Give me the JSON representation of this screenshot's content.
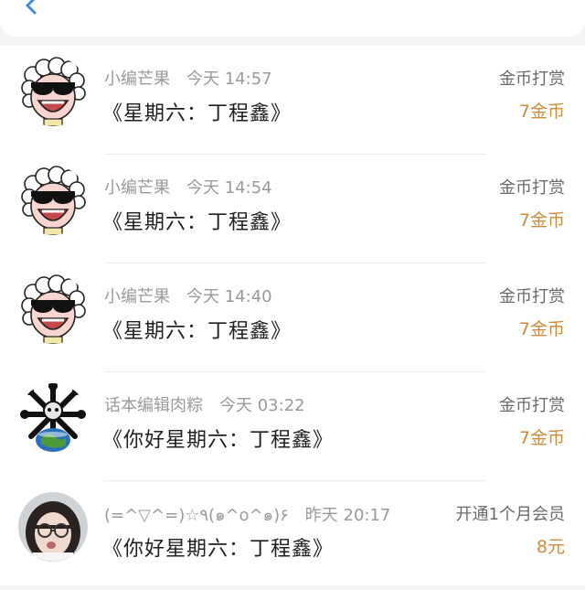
{
  "colors": {
    "accent": "#3a8ee6",
    "amount": "#d08a3c"
  },
  "header": {
    "back_icon": "chevron-left-icon"
  },
  "items": [
    {
      "name": "小编芒果",
      "time": "今天 14:57",
      "title": "《星期六：丁程鑫》",
      "action": "金币打赏",
      "amount": "7金币",
      "avatar": "sheep-sunglasses"
    },
    {
      "name": "小编芒果",
      "time": "今天 14:54",
      "title": "《星期六：丁程鑫》",
      "action": "金币打赏",
      "amount": "7金币",
      "avatar": "sheep-sunglasses"
    },
    {
      "name": "小编芒果",
      "time": "今天 14:40",
      "title": "《星期六：丁程鑫》",
      "action": "金币打赏",
      "amount": "7金币",
      "avatar": "sheep-sunglasses"
    },
    {
      "name": "话本编辑肉粽",
      "time": "今天 03:22",
      "title": "《你好星期六：丁程鑫》",
      "action": "金币打赏",
      "amount": "7金币",
      "avatar": "earth-skull"
    },
    {
      "name": "(=^▽^=)☆٩(๑^o^๑)۶",
      "time": "昨天 20:17",
      "title": "《你好星期六：丁程鑫》",
      "action": "开通1个月会员",
      "amount": "8元",
      "avatar": "girl-photo"
    }
  ]
}
